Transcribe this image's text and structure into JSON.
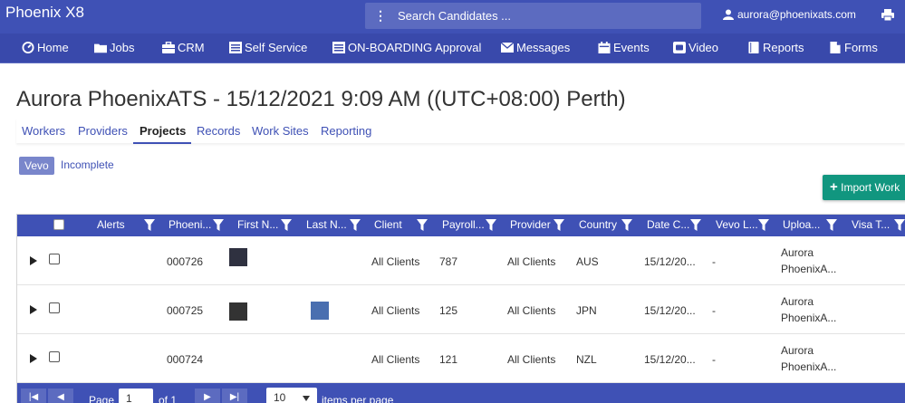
{
  "app": {
    "name": "Phoenix X8",
    "search_placeholder": "Search Candidates ...",
    "user_email": "aurora@phoenixats.com",
    "icons": {
      "menu": "vertical-dots-icon",
      "user": "user-icon",
      "print": "print-icon"
    }
  },
  "nav": {
    "items": [
      {
        "label": "Home",
        "icon": "dashboard-icon"
      },
      {
        "label": "Jobs",
        "icon": "folder-icon"
      },
      {
        "label": "CRM",
        "icon": "briefcase-icon"
      },
      {
        "label": "Self Service",
        "icon": "list-icon"
      },
      {
        "label": "ON-BOARDING Approval",
        "icon": "list-icon"
      },
      {
        "label": "Messages",
        "icon": "envelope-icon"
      },
      {
        "label": "Events",
        "icon": "calendar-icon"
      },
      {
        "label": "Video",
        "icon": "video-icon"
      },
      {
        "label": "Reports",
        "icon": "book-icon"
      },
      {
        "label": "Forms",
        "icon": "file-icon"
      }
    ]
  },
  "page": {
    "title": "Aurora PhoenixATS - 15/12/2021 9:09 AM ((UTC+08:00) Perth)"
  },
  "tabs": [
    {
      "label": "Workers",
      "active": false
    },
    {
      "label": "Providers",
      "active": false
    },
    {
      "label": "Projects",
      "active": true
    },
    {
      "label": "Records",
      "active": false
    },
    {
      "label": "Work Sites",
      "active": false
    },
    {
      "label": "Reporting",
      "active": false
    }
  ],
  "filters": {
    "active_chip": "Vevo",
    "link": "Incomplete"
  },
  "actions": {
    "import_label": "Import Work"
  },
  "grid": {
    "columns": [
      "Alerts",
      "Phoeni...",
      "First N...",
      "Last N...",
      "Client",
      "Payroll...",
      "Provider",
      "Country",
      "Date C...",
      "Vevo L...",
      "Uploa...",
      "Visa T..."
    ],
    "rows": [
      {
        "id": "000726",
        "client": "All Clients",
        "payroll": "787",
        "provider": "All Clients",
        "country": "AUS",
        "date": "15/12/20...",
        "vevo": "-",
        "upload_line1": "Aurora",
        "upload_line2": "PhoenixA...",
        "first_swatch": "#2f3140",
        "last_swatch": ""
      },
      {
        "id": "000725",
        "client": "All Clients",
        "payroll": "125",
        "provider": "All Clients",
        "country": "JPN",
        "date": "15/12/20...",
        "vevo": "-",
        "upload_line1": "Aurora",
        "upload_line2": "PhoenixA...",
        "first_swatch": "#333333",
        "last_swatch": "#4a6fb0"
      },
      {
        "id": "000724",
        "client": "All Clients",
        "payroll": "121",
        "provider": "All Clients",
        "country": "NZL",
        "date": "15/12/20...",
        "vevo": "-",
        "upload_line1": "Aurora",
        "upload_line2": "PhoenixA...",
        "first_swatch": "",
        "last_swatch": ""
      }
    ]
  },
  "pager": {
    "page_label": "Page",
    "page_value": "1",
    "of_label": "of 1",
    "per_page_value": "10",
    "per_page_label": "items per page"
  },
  "colors": {
    "primary": "#3f51b5",
    "nav": "#3949ab",
    "accent_button": "#11967f",
    "chip": "#7986cb"
  }
}
